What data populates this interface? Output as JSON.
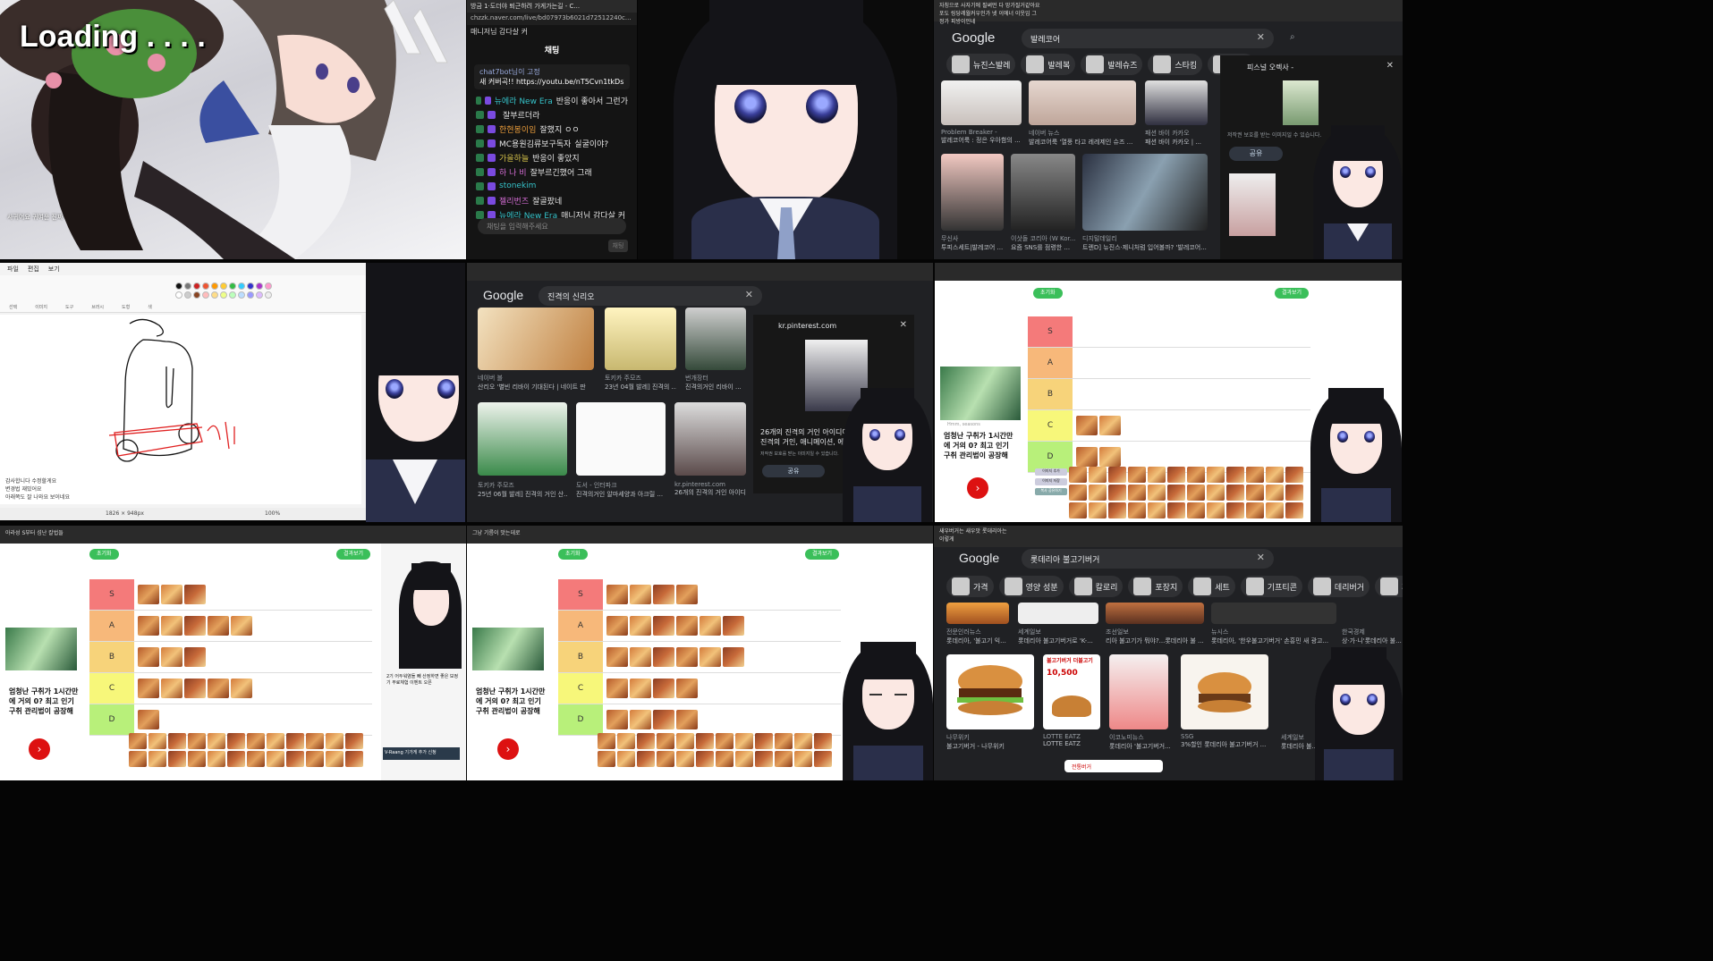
{
  "panel1": {
    "loading": "Loading . . . .",
    "side_lines": [
      "사귀어요 귀여운 진짜"
    ]
  },
  "panel2": {
    "tab_title": "방금 1·도더야 퇴근하려 가게가는길 - C...",
    "url": "chzzk.naver.com/live/bd07973b6021d72512240c...",
    "window_title": "채팅",
    "header_notice": "매니저님 감다살 커",
    "pinned_user": "chat7bot님이 고정",
    "pinned_text": "새 커버곡!! https://youtu.be/nT5Cvn1tkDs?si...",
    "messages": [
      {
        "user": "뉴에라 New Era",
        "text": "반응이 좋아서 그런가",
        "color": "#35c2c9"
      },
      {
        "user": "",
        "text": "잘부르더라",
        "color": "#e6e6e6"
      },
      {
        "user": "한현봉이임",
        "text": "잘했지 ㅇㅇ",
        "color": "#e89b3a"
      },
      {
        "user": "MC용원김류보구독자",
        "text": "실굴이야?",
        "color": "#e6e6e6"
      },
      {
        "user": "가을하늘",
        "text": "반응이 좋았지",
        "color": "#d6c24a"
      },
      {
        "user": "하 나 비",
        "text": "잘부르긴했어 그래",
        "color": "#d16bd1"
      },
      {
        "user": "stonekim",
        "text": "",
        "color": "#35c2c9"
      },
      {
        "user": "젤리번즈",
        "text": "잘골팠네",
        "color": "#d16bd1"
      },
      {
        "user": "뉴에라 New Era",
        "text": "매니저님 감다살 커",
        "color": "#35c2c9"
      }
    ],
    "input_placeholder": "채팅을 입력해주세요",
    "send_label": "채팅"
  },
  "panel4": {
    "search_query": "발레코어",
    "header_lines": [
      "자칭으로 사자기에 필써먼 다 망가질거같아요",
      "포도 링당레월커우인가 넷 이에너 이웃임 그",
      "정가 피방이인네"
    ],
    "chips": [
      "뉴진스발레",
      "발레복",
      "발레슈즈",
      "스타킹",
      "패션"
    ],
    "results": [
      {
        "source": "Problem Breaker -",
        "title": "발레코어룩 : 정은 우아함의 ..."
      },
      {
        "source": "네이버 뉴스",
        "title": "발레코어룩 '열풍 타고 레레제인 슈즈 ..."
      },
      {
        "source": "패션 바이 카카오",
        "title": "패션 바이 카카오 | ..."
      },
      {
        "source": "무신사",
        "title": "발레슈즈 ..."
      },
      {
        "source": "무신사",
        "title": "투피스세트|발레코어 ..."
      },
      {
        "source": "이삿돌 코리아 (W Kor...",
        "title": "요즘 SNS를 점령한 ..."
      },
      {
        "source": "디지털데일리",
        "title": "트렌D] 뉴진스·제니처럼 입어볼까? '발레코어..."
      }
    ],
    "side_title": "피스널 오렉사 -",
    "side_share": "공유",
    "side_caption": "저작권 보호를 받는 이미지일 수 있습니다."
  },
  "panel5": {
    "menu": [
      "파일",
      "편집",
      "보기"
    ],
    "tool_labels": [
      "선택",
      "이미지",
      "도구",
      "브러시",
      "도형",
      "색"
    ],
    "status": "1826 × 948px",
    "zoom": "100%",
    "side_lines": [
      "감사합니다 수정할게요",
      "변경법 재밌어요",
      "아래쪽도 잘 나와요 보이네요"
    ]
  },
  "panel6": {
    "search_query": "진격의 신리오",
    "results": [
      {
        "source": "네이버 블",
        "title": "산리오 '별빈 리바이 기대된다 | 네이트 판"
      },
      {
        "source": "토키카 주모즈",
        "title": "23년 04월 발레] 진격의 ..."
      },
      {
        "source": "번개장터",
        "title": "진격의거인 리바이 ..."
      },
      {
        "source": "토키카 주모즈",
        "title": "25년 06월 발레] 진격의 거인 산..."
      },
      {
        "source": "도서 - 인터파크",
        "title": "진격의거인 알마세양과 아크릴 ..."
      },
      {
        "source": "kr.pinterest.com",
        "title": "26개의 진격의 거인 아이디..."
      }
    ],
    "side_site": "kr.pinterest.com",
    "side_title": "26개의 진격의 거인 아이디어 | 진격의 거인, 애니메이션, 에렌",
    "side_caption": "저작권 보호를 받는 이미지일 수 있습니다.",
    "side_share": "공유"
  },
  "tier_common": {
    "tiers": [
      {
        "label": "S",
        "color": "#f47a7a"
      },
      {
        "label": "A",
        "color": "#f7b87a"
      },
      {
        "label": "B",
        "color": "#f7d37a"
      },
      {
        "label": "C",
        "color": "#f7f77a"
      },
      {
        "label": "D",
        "color": "#b8f07a"
      }
    ],
    "top_left_btn": "초기화",
    "top_right_btn": "결과보기",
    "ad_text": "엄청난 구취가 1시간만에 거의 0? 최고 인기 구취 관리법이 공장해",
    "ad_tag": "Hmm, seasons",
    "side_buttons": [
      "이미지 추가",
      "이미지 저장",
      "복사 공유하기"
    ]
  },
  "panel7": {
    "counts": [
      0,
      0,
      0,
      2,
      2
    ]
  },
  "panel8": {
    "header": "아라성 S부터 섬난 칼법들",
    "counts": [
      3,
      5,
      3,
      5,
      1
    ],
    "side_text": "2기 어두워염들 빼 산정하면 좋은 보정 기 무료체험 이벤트 오픈",
    "promo": "V-Raang 기가게 추가 신청"
  },
  "panel9": {
    "header": "그냥 기름이 맛는데로",
    "counts": [
      4,
      6,
      6,
      4,
      4
    ]
  },
  "panel10": {
    "search_query": "롯데리아 불고기버거",
    "header_lines": [
      "새우버거는 새우맛 롯데리아는",
      "이렇게"
    ],
    "chips": [
      "가격",
      "영양 성분",
      "칼로리",
      "포장지",
      "세트",
      "기프티콘",
      "데리버거",
      "후기"
    ],
    "results": [
      {
        "source": "전문인러뉴스",
        "title": "롯데리아, '불고기 익..."
      },
      {
        "source": "세계일보",
        "title": "롯데리아 불고기버거로 'K-..."
      },
      {
        "source": "조선일보",
        "title": "리아 불고기가 뭐야?...롯데리아 불 ..."
      },
      {
        "source": "뉴시스",
        "title": "롯데리아, '한우불고기버거' 손흥민 새 광고..."
      },
      {
        "source": "한국경제",
        "title": "상·가·니'롯데리아 불..."
      },
      {
        "source": "나무위키",
        "title": "불고기버거 - 나무위키"
      },
      {
        "source": "LOTTE EATZ",
        "title": "LOTTE EATZ"
      },
      {
        "source": "이코노미뉴스",
        "title": "롯데리아 '불고기버거..."
      },
      {
        "source": "SSG",
        "title": "3%할인 롯데리아 불고기버거 ..."
      },
      {
        "source": "세계일보",
        "title": "롯데리아 불..."
      }
    ],
    "promo_price": "10,500",
    "promo_title": "불고기버거 더블고기",
    "ad_right": "LO",
    "bottom_chip": "전통버거"
  },
  "colors": {
    "chat_bg": "#141414",
    "google_dark": "#202124",
    "tier_red": "#d11111"
  }
}
